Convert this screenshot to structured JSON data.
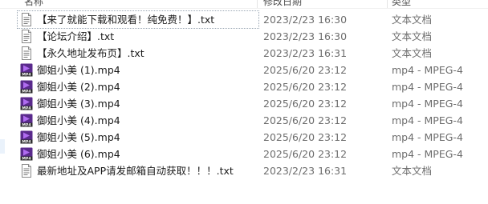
{
  "header": {
    "name_label": "名称",
    "date_label": "修改日期",
    "type_label": "类型"
  },
  "colors": {
    "mp4_icon_bg": "#5a2a8c",
    "mp4_play": "#b06cf0",
    "txt_icon_line": "#7a7a7a",
    "secondary_text": "#6d6d6d"
  },
  "files": [
    {
      "name": "【来了就能下载和观看！纯免费！】.txt",
      "date": "2023/2/23 16:30",
      "type": "文本文档",
      "icon": "text-file-icon"
    },
    {
      "name": "【论坛介绍】.txt",
      "date": "2023/2/23 16:30",
      "type": "文本文档",
      "icon": "text-file-icon"
    },
    {
      "name": "【永久地址发布页】.txt",
      "date": "2023/2/23 16:31",
      "type": "文本文档",
      "icon": "text-file-icon"
    },
    {
      "name": "御姐小美 (1).mp4",
      "date": "2025/6/20 23:12",
      "type": "mp4 - MPEG-4",
      "icon": "mp4-video-icon"
    },
    {
      "name": "御姐小美 (2).mp4",
      "date": "2025/6/20 23:12",
      "type": "mp4 - MPEG-4",
      "icon": "mp4-video-icon"
    },
    {
      "name": "御姐小美 (3).mp4",
      "date": "2025/6/20 23:12",
      "type": "mp4 - MPEG-4",
      "icon": "mp4-video-icon"
    },
    {
      "name": "御姐小美 (4).mp4",
      "date": "2025/6/20 23:12",
      "type": "mp4 - MPEG-4",
      "icon": "mp4-video-icon"
    },
    {
      "name": "御姐小美 (5).mp4",
      "date": "2025/6/20 23:12",
      "type": "mp4 - MPEG-4",
      "icon": "mp4-video-icon"
    },
    {
      "name": "御姐小美 (6).mp4",
      "date": "2025/6/20 23:12",
      "type": "mp4 - MPEG-4",
      "icon": "mp4-video-icon"
    },
    {
      "name": "最新地址及APP请发邮箱自动获取！！！.txt",
      "date": "2023/2/23 16:31",
      "type": "文本文档",
      "icon": "text-file-icon"
    }
  ],
  "mp4_badge": "MP4"
}
